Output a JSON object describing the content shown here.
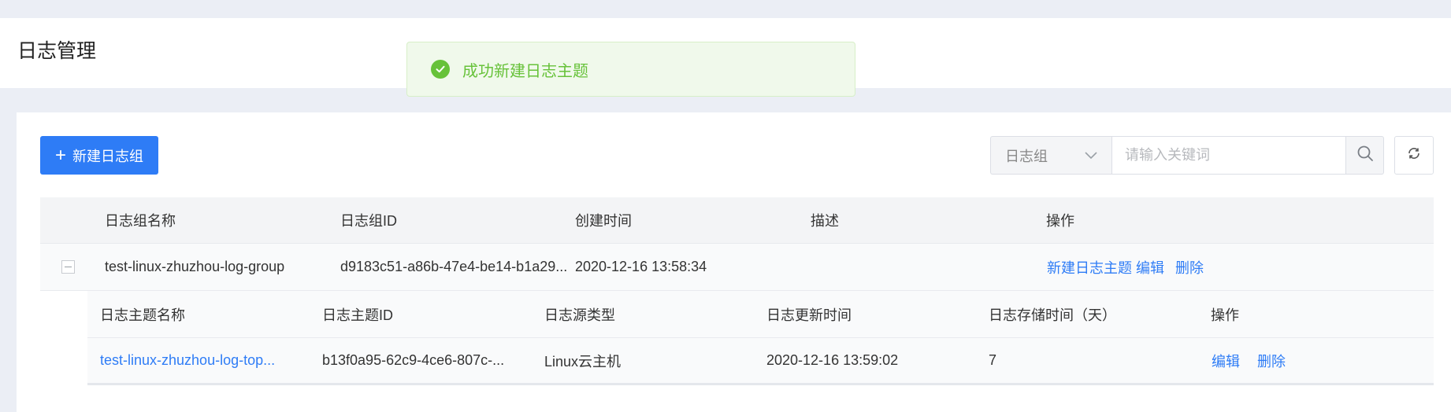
{
  "page": {
    "title": "日志管理"
  },
  "toast": {
    "message": "成功新建日志主题",
    "icon": "check-circle-icon",
    "color": "#67c23a"
  },
  "toolbar": {
    "new_group_label": "新建日志组",
    "select_value": "日志组",
    "search_placeholder": "请输入关键词",
    "search_icon": "search-icon",
    "refresh_icon": "refresh-icon"
  },
  "group_table": {
    "headers": [
      "日志组名称",
      "日志组ID",
      "创建时间",
      "描述",
      "操作"
    ],
    "rows": [
      {
        "name": "test-linux-zhuzhou-log-group",
        "id": "d9183c51-a86b-47e4-be14-b1a29...",
        "created": "2020-12-16 13:58:34",
        "description": "",
        "actions": [
          "新建日志主题",
          "编辑",
          "删除"
        ]
      }
    ]
  },
  "topic_table": {
    "headers": [
      "日志主题名称",
      "日志主题ID",
      "日志源类型",
      "日志更新时间",
      "日志存储时间（天）",
      "操作"
    ],
    "rows": [
      {
        "name": "test-linux-zhuzhou-log-top...",
        "id": "b13f0a95-62c9-4ce6-807c-...",
        "source_type": "Linux云主机",
        "updated": "2020-12-16 13:59:02",
        "retention_days": "7",
        "actions": [
          "编辑",
          "删除"
        ]
      }
    ]
  },
  "colors": {
    "primary": "#2e7cf6",
    "success": "#67c23a",
    "background": "#ebeef5"
  }
}
